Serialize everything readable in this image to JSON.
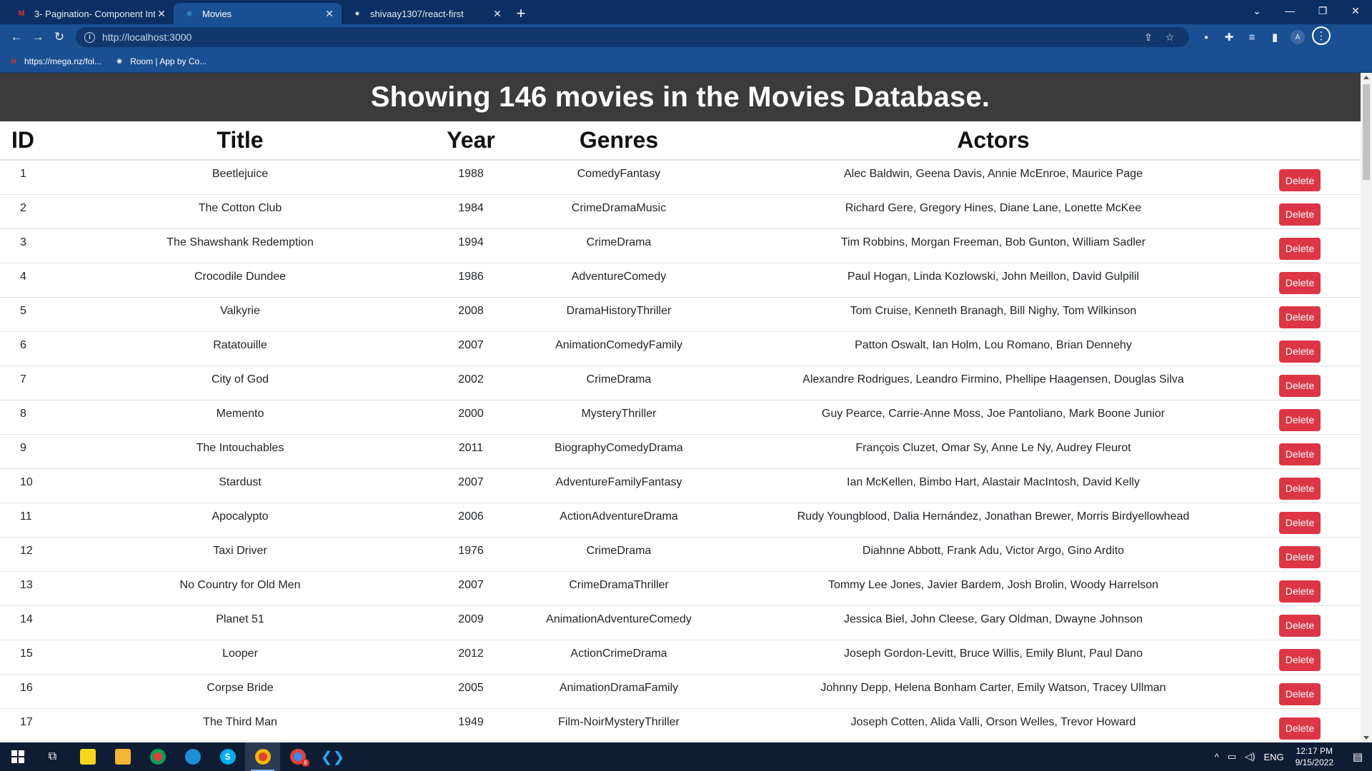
{
  "browser": {
    "tabs": [
      {
        "title": "3- Pagination- Component Interf",
        "favicon": "M",
        "favicon_color": "#d93025",
        "active": false
      },
      {
        "title": "Movies",
        "favicon": "⚛",
        "favicon_color": "#61dafb",
        "active": true
      },
      {
        "title": "shivaay1307/react-first",
        "favicon": "●",
        "favicon_color": "#ffffff",
        "active": false
      }
    ],
    "new_tab_label": "+",
    "url": "http://localhost:3000",
    "bookmarks": [
      {
        "label": "https://mega.nz/fol...",
        "icon": "M",
        "icon_color": "#d93025"
      },
      {
        "label": "Room | App by Co...",
        "icon": "◉",
        "icon_color": "#ffffff"
      }
    ],
    "profile_initial": "A"
  },
  "page": {
    "banner": "Showing 146 movies in the Movies Database.",
    "columns": {
      "id": "ID",
      "title": "Title",
      "year": "Year",
      "genres": "Genres",
      "actors": "Actors"
    },
    "delete_label": "Delete",
    "movies": [
      {
        "id": "1",
        "title": "Beetlejuice",
        "year": "1988",
        "genres": "ComedyFantasy",
        "actors": "Alec Baldwin, Geena Davis, Annie McEnroe, Maurice Page"
      },
      {
        "id": "2",
        "title": "The Cotton Club",
        "year": "1984",
        "genres": "CrimeDramaMusic",
        "actors": "Richard Gere, Gregory Hines, Diane Lane, Lonette McKee"
      },
      {
        "id": "3",
        "title": "The Shawshank Redemption",
        "year": "1994",
        "genres": "CrimeDrama",
        "actors": "Tim Robbins, Morgan Freeman, Bob Gunton, William Sadler"
      },
      {
        "id": "4",
        "title": "Crocodile Dundee",
        "year": "1986",
        "genres": "AdventureComedy",
        "actors": "Paul Hogan, Linda Kozlowski, John Meillon, David Gulpilil"
      },
      {
        "id": "5",
        "title": "Valkyrie",
        "year": "2008",
        "genres": "DramaHistoryThriller",
        "actors": "Tom Cruise, Kenneth Branagh, Bill Nighy, Tom Wilkinson"
      },
      {
        "id": "6",
        "title": "Ratatouille",
        "year": "2007",
        "genres": "AnimationComedyFamily",
        "actors": "Patton Oswalt, Ian Holm, Lou Romano, Brian Dennehy"
      },
      {
        "id": "7",
        "title": "City of God",
        "year": "2002",
        "genres": "CrimeDrama",
        "actors": "Alexandre Rodrigues, Leandro Firmino, Phellipe Haagensen, Douglas Silva"
      },
      {
        "id": "8",
        "title": "Memento",
        "year": "2000",
        "genres": "MysteryThriller",
        "actors": "Guy Pearce, Carrie-Anne Moss, Joe Pantoliano, Mark Boone Junior"
      },
      {
        "id": "9",
        "title": "The Intouchables",
        "year": "2011",
        "genres": "BiographyComedyDrama",
        "actors": "François Cluzet, Omar Sy, Anne Le Ny, Audrey Fleurot"
      },
      {
        "id": "10",
        "title": "Stardust",
        "year": "2007",
        "genres": "AdventureFamilyFantasy",
        "actors": "Ian McKellen, Bimbo Hart, Alastair MacIntosh, David Kelly"
      },
      {
        "id": "11",
        "title": "Apocalypto",
        "year": "2006",
        "genres": "ActionAdventureDrama",
        "actors": "Rudy Youngblood, Dalia Hernández, Jonathan Brewer, Morris Birdyellowhead"
      },
      {
        "id": "12",
        "title": "Taxi Driver",
        "year": "1976",
        "genres": "CrimeDrama",
        "actors": "Diahnne Abbott, Frank Adu, Victor Argo, Gino Ardito"
      },
      {
        "id": "13",
        "title": "No Country for Old Men",
        "year": "2007",
        "genres": "CrimeDramaThriller",
        "actors": "Tommy Lee Jones, Javier Bardem, Josh Brolin, Woody Harrelson"
      },
      {
        "id": "14",
        "title": "Planet 51",
        "year": "2009",
        "genres": "AnimationAdventureComedy",
        "actors": "Jessica Biel, John Cleese, Gary Oldman, Dwayne Johnson"
      },
      {
        "id": "15",
        "title": "Looper",
        "year": "2012",
        "genres": "ActionCrimeDrama",
        "actors": "Joseph Gordon-Levitt, Bruce Willis, Emily Blunt, Paul Dano"
      },
      {
        "id": "16",
        "title": "Corpse Bride",
        "year": "2005",
        "genres": "AnimationDramaFamily",
        "actors": "Johnny Depp, Helena Bonham Carter, Emily Watson, Tracey Ullman"
      },
      {
        "id": "17",
        "title": "The Third Man",
        "year": "1949",
        "genres": "Film-NoirMysteryThriller",
        "actors": "Joseph Cotten, Alida Valli, Orson Welles, Trevor Howard"
      }
    ]
  },
  "taskbar": {
    "language": "ENG",
    "time": "12:17 PM",
    "date": "9/15/2022",
    "badge_count": "8"
  },
  "colors": {
    "danger": "#dc3545",
    "banner_bg": "#3b3b3b",
    "chrome_bg": "#1a4f93"
  }
}
